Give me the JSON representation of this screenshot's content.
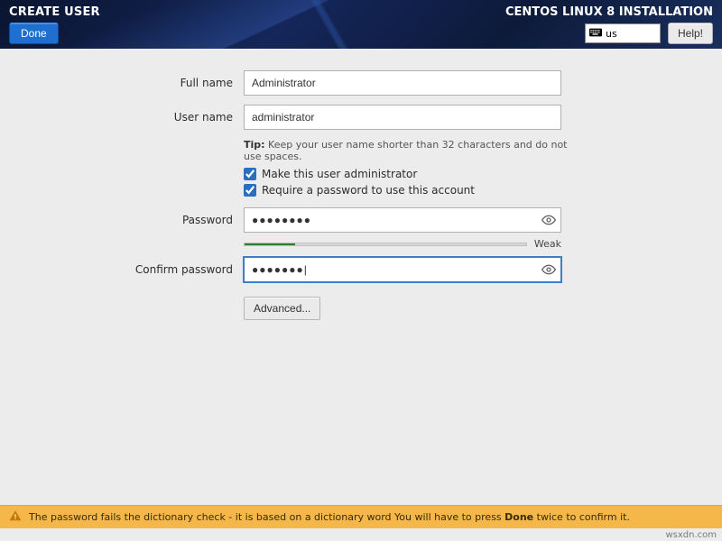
{
  "header": {
    "title": "CREATE USER",
    "done_label": "Done",
    "install_title": "CENTOS LINUX 8 INSTALLATION",
    "keyboard_layout": "us",
    "help_label": "Help!"
  },
  "form": {
    "full_name_label": "Full name",
    "full_name_value": "Administrator",
    "user_name_label": "User name",
    "user_name_value": "administrator",
    "tip_prefix": "Tip:",
    "tip_text": " Keep your user name shorter than 32 characters and do not use spaces.",
    "chk_admin_label": "Make this user administrator",
    "chk_admin_checked": true,
    "chk_pw_label": "Require a password to use this account",
    "chk_pw_checked": true,
    "password_label": "Password",
    "password_value": "●●●●●●●●",
    "strength_label": "Weak",
    "confirm_label": "Confirm password",
    "confirm_value": "●●●●●●●|",
    "advanced_label": "Advanced..."
  },
  "warning": {
    "text_before": "The password fails the dictionary check - it is based on a dictionary word You will have to press ",
    "done_word": "Done",
    "text_after": " twice to confirm it."
  },
  "attribution": "wsxdn.com"
}
